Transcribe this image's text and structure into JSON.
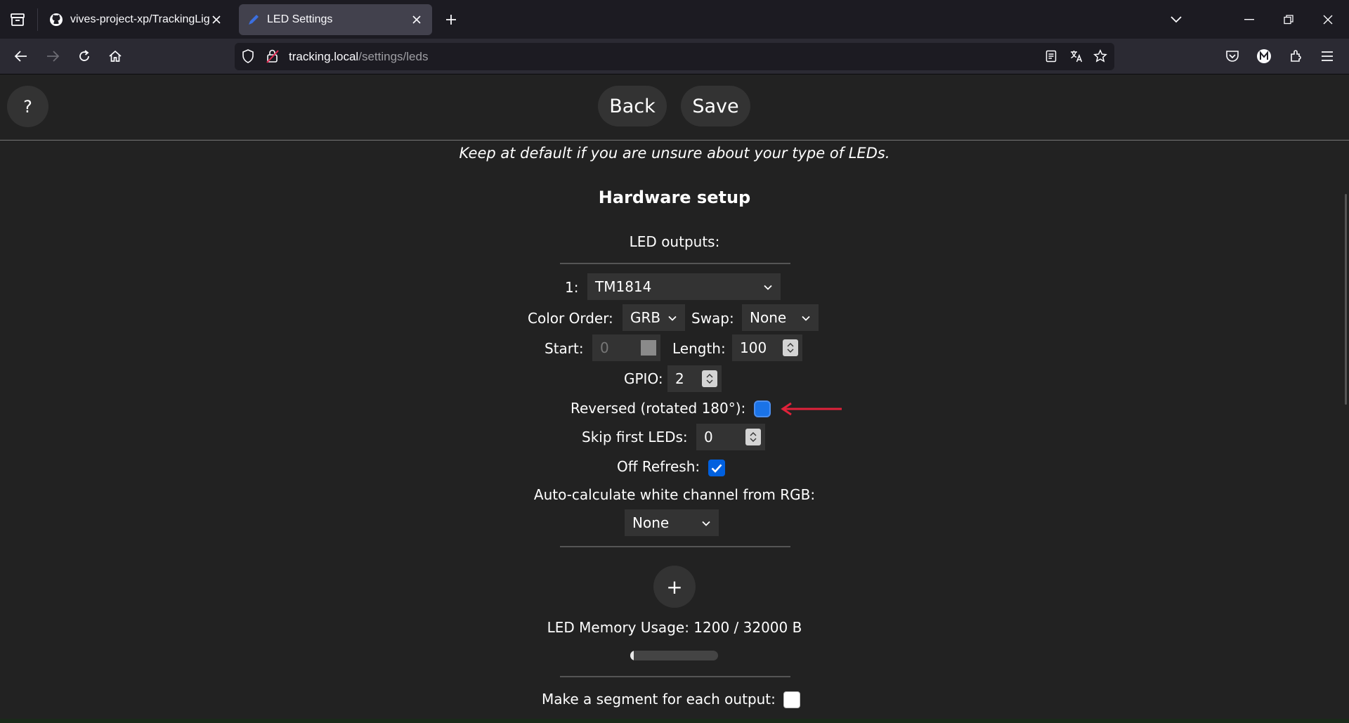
{
  "browser": {
    "tabs": [
      {
        "title": "vives-project-xp/TrackingLights",
        "active": false,
        "icon": "github-icon"
      },
      {
        "title": "LED Settings",
        "active": true,
        "icon": "pencil-icon"
      }
    ],
    "url_host": "tracking.local",
    "url_path": "/settings/leds"
  },
  "header": {
    "help_label": "?",
    "back_label": "Back",
    "save_label": "Save"
  },
  "page": {
    "note": "Keep at default if you are unsure about your type of LEDs.",
    "section_title": "Hardware setup",
    "led_outputs_label": "LED outputs:",
    "output": {
      "index_label": "1:",
      "led_type": "TM1814",
      "color_order_label": "Color Order:",
      "color_order": "GRB",
      "swap_label": "Swap:",
      "swap": "None",
      "start_label": "Start:",
      "start": "0",
      "length_label": "Length:",
      "length": "100",
      "gpio_label": "GPIO:",
      "gpio": "2",
      "reversed_label": "Reversed (rotated 180°):",
      "reversed_checked": false,
      "skip_label": "Skip first LEDs:",
      "skip": "0",
      "off_refresh_label": "Off Refresh:",
      "off_refresh_checked": true,
      "auto_white_label": "Auto-calculate white channel from RGB:",
      "auto_white": "None"
    },
    "add_output_label": "+",
    "memory_usage": "LED Memory Usage: 1200 / 32000 B",
    "memory_fraction": 0.0375,
    "segment_label": "Make a segment for each output:",
    "segment_checked": false
  },
  "colors": {
    "accent": "#0060df",
    "annotation_arrow": "#e0223a",
    "page_bg": "#222222"
  }
}
